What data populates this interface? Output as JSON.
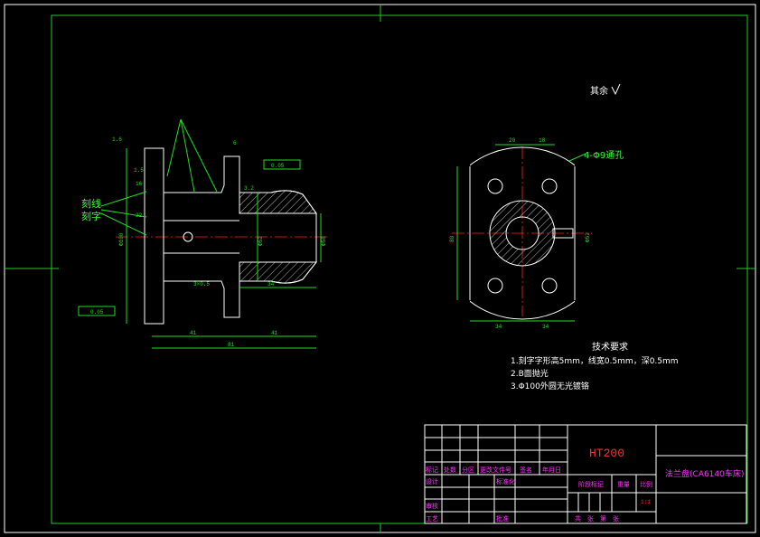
{
  "colors": {
    "background": "#000000",
    "frame": "#ffffff",
    "border": "#22cc22",
    "outline": "#ffffff",
    "dimension": "#22dd22",
    "centerline": "#ff2222",
    "hatch": "#ffffff",
    "titleblock_text": "#ff33ff",
    "material_text": "#ff3333",
    "note_text": "#ffffff",
    "label_text": "#33ff33"
  },
  "surface_note": "其余",
  "callouts": {
    "left": [
      "刻线",
      "刻字"
    ],
    "hole": "4-Φ9通孔"
  },
  "dims_left": {
    "d1": "1.6",
    "d2": "3.2",
    "d3": "6",
    "d4": "1.5",
    "d5": "16",
    "d6": "22",
    "d7": "Φ100",
    "d8": "41",
    "d9": "41",
    "d10": "81",
    "d11": "34",
    "d12": "3×0.5",
    "d13": "Φ58",
    "d14": "Φ52",
    "tol1": "0.05",
    "tol2": "0.05"
  },
  "dims_right": {
    "w1": "20",
    "w2": "18",
    "b1": "34",
    "b2": "34",
    "h1": "80",
    "c1": "Φ52"
  },
  "tech_req": {
    "title": "技术要求",
    "items": [
      "1.刻字字形高5mm，线宽0.5mm，深0.5mm",
      "2.B面抛光",
      "3.Φ100外圆无光镀铬"
    ]
  },
  "title_block": {
    "material": "HT200",
    "part_name": "法兰盘(CA6140车床)",
    "row_labels": [
      "标记",
      "处数",
      "分区",
      "更改文件号",
      "签名",
      "年月日"
    ],
    "design": "设计",
    "standardize": "标准化",
    "review": "审核",
    "process": "工艺",
    "approve": "批准",
    "stage_mark": "阶段标记",
    "weight": "重量",
    "scale": "比例",
    "scale_value": "1:1",
    "sheets": "共　张　第　张"
  }
}
